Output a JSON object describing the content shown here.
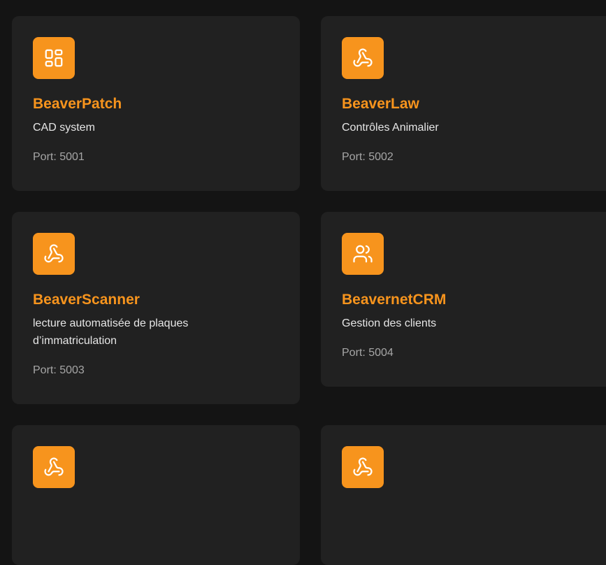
{
  "cards": [
    {
      "title": "BeaverPatch",
      "description": "CAD system",
      "port": "Port: 5001",
      "icon": "dashboard-icon"
    },
    {
      "title": "BeaverLaw",
      "description": "Contrôles Animalier",
      "port": "Port: 5002",
      "icon": "webhook-icon"
    },
    {
      "title": "BeaverScanner",
      "description": "lecture automatisée de plaques d’immatriculation",
      "port": "Port: 5003",
      "icon": "webhook-icon"
    },
    {
      "title": "BeavernetCRM",
      "description": "Gestion des clients",
      "port": "Port: 5004",
      "icon": "users-icon"
    },
    {
      "title": "",
      "description": "",
      "port": "",
      "icon": "webhook-icon"
    },
    {
      "title": "",
      "description": "",
      "port": "",
      "icon": "webhook-icon"
    }
  ],
  "colors": {
    "accent": "#f7941d",
    "background": "#141414",
    "card": "#212121"
  }
}
